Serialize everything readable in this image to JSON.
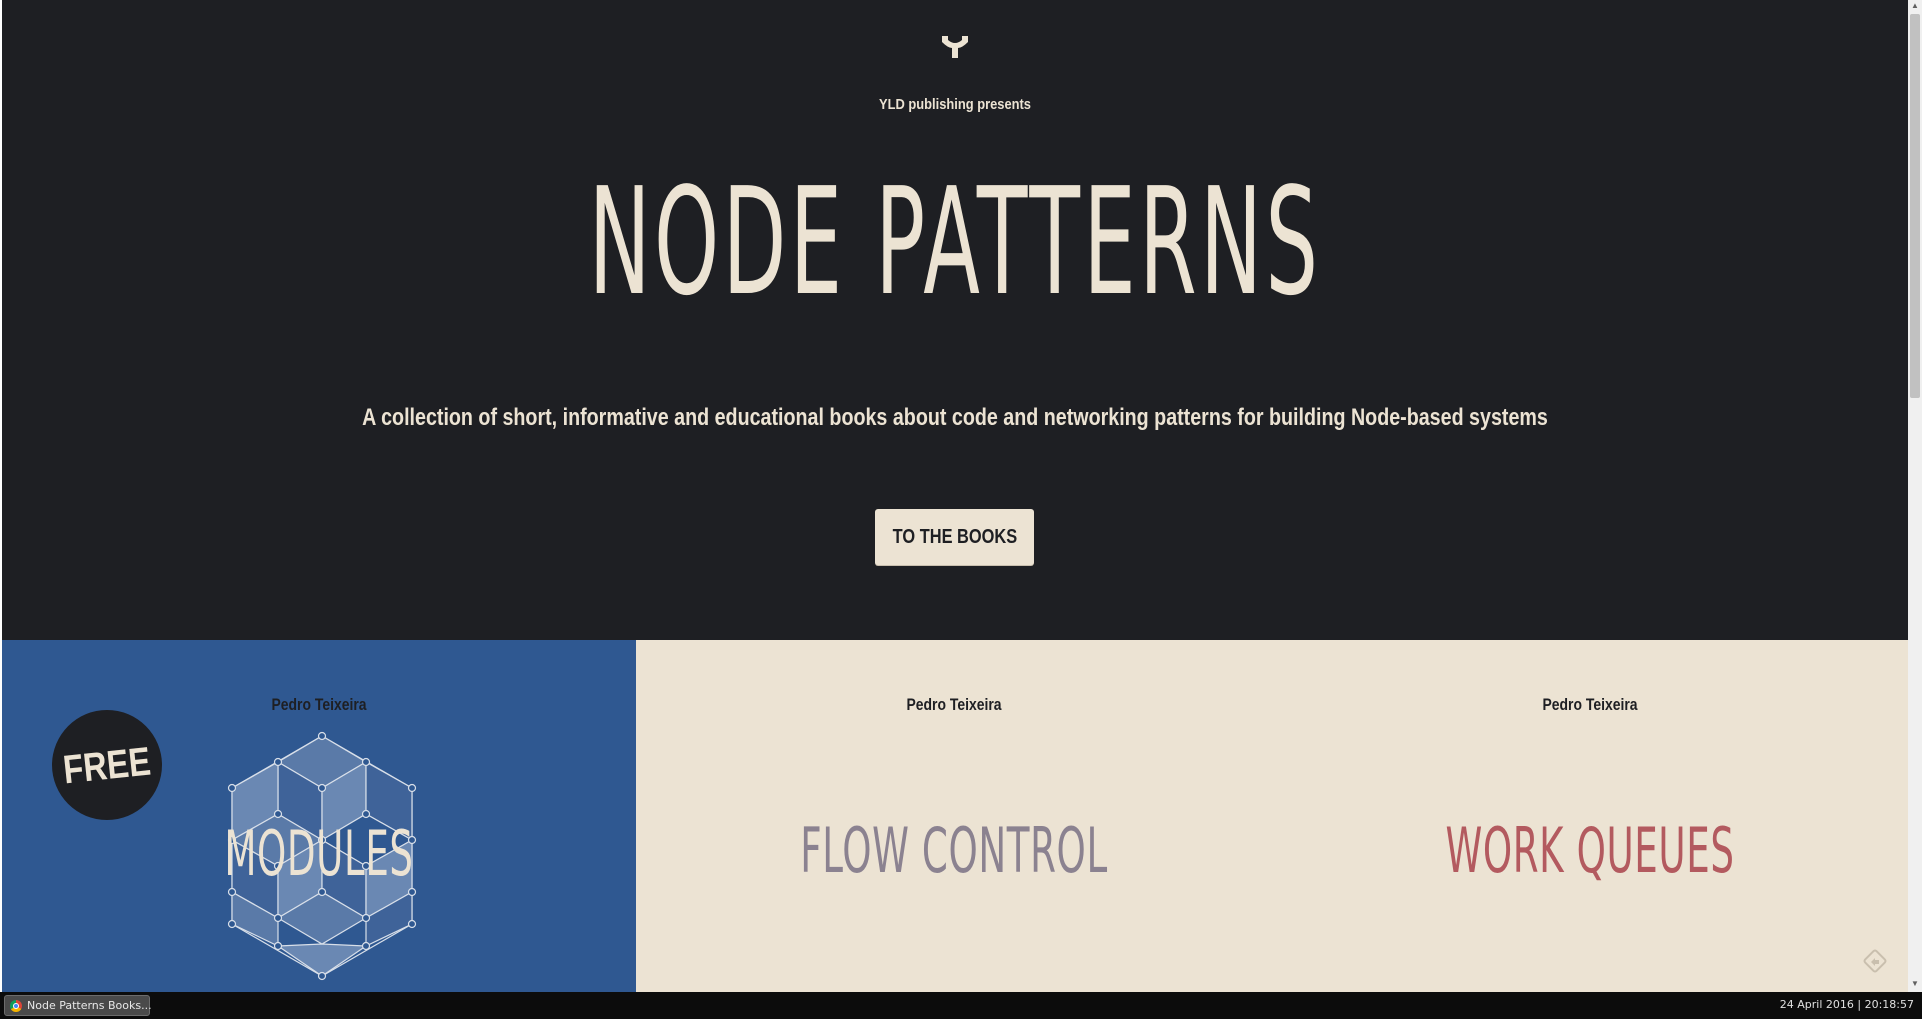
{
  "hero": {
    "presents": "YLD publishing presents",
    "title": "NODE PATTERNS",
    "tagline": "A collection of short, informative and educational books about code and networking patterns for building Node-based systems",
    "cta_label": "TO THE BOOKS"
  },
  "books": [
    {
      "author": "Pedro Teixeira",
      "title": "MODULES",
      "badge": "FREE",
      "color": "#2f5891"
    },
    {
      "author": "Pedro Teixeira",
      "title": "FLOW CONTROL",
      "color": "#8b8290"
    },
    {
      "author": "Pedro Teixeira",
      "title": "WORK QUEUES",
      "color": "#b35a5f"
    }
  ],
  "taskbar": {
    "window_label": "Node Patterns Books...",
    "clock": "24 April 2016 | 20:18:57"
  },
  "icons": {
    "logo": "yld-logo-icon",
    "share": "share-icon",
    "browser": "chrome-icon"
  }
}
